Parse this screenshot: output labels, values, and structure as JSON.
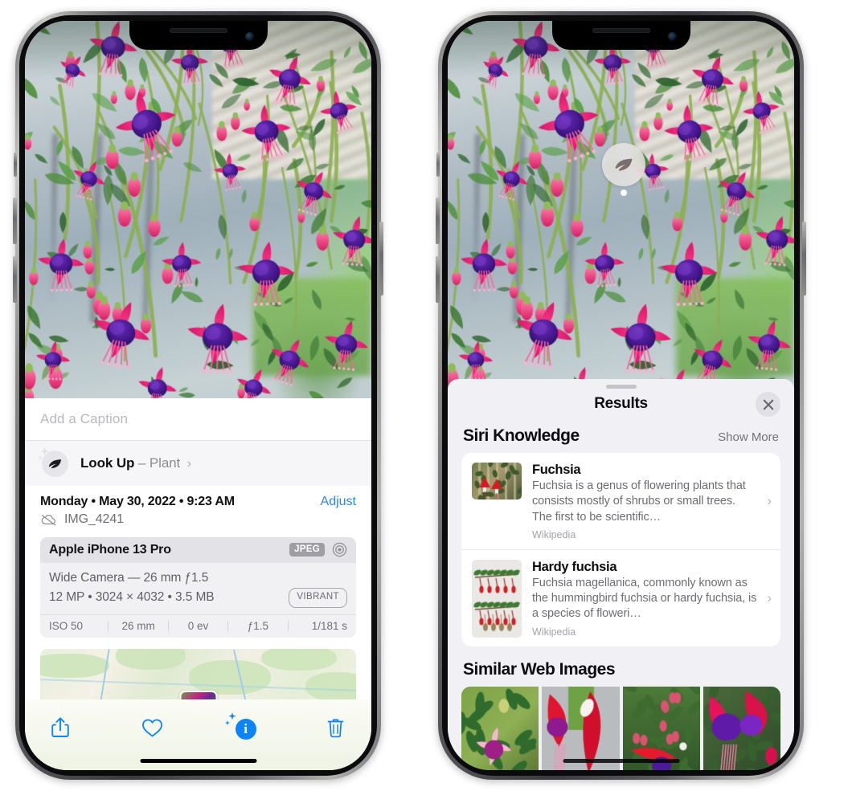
{
  "left_phone": {
    "name": "iPhone showing Photos app info view",
    "caption_input": {
      "placeholder": "Add a Caption",
      "value": ""
    },
    "lookup_row": {
      "icon": "leaf-sparkle-icon",
      "label": "Look Up",
      "dash": "–",
      "subject": "Plant",
      "chevron": "›"
    },
    "metadata": {
      "date": "Monday • May 30, 2022 • 9:23 AM",
      "adjust_label": "Adjust",
      "cloud_icon": "icloud-slash-icon",
      "filename": "IMG_4241"
    },
    "exif": {
      "device": "Apple iPhone 13 Pro",
      "format_badge": "JPEG",
      "raw_icon": "raw-target-icon",
      "lens_line": "Wide Camera — 26 mm ƒ1.5",
      "size_line": "12 MP • 3024 × 4032 • 3.5 MB",
      "style_badge": "VIBRANT",
      "stats": [
        "ISO 50",
        "26 mm",
        "0 ev",
        "ƒ1.5",
        "1/181 s"
      ]
    },
    "toolbar": {
      "share_label": "Share",
      "favorite_label": "Favorite",
      "info_label": "Info",
      "delete_label": "Delete"
    }
  },
  "right_phone": {
    "name": "iPhone showing Visual Look Up results",
    "photo_badge": {
      "icon": "leaf-icon",
      "label": "Plant"
    },
    "sheet": {
      "title": "Results",
      "close_icon": "close-icon",
      "grabber": "drag-handle"
    },
    "siri_knowledge": {
      "heading": "Siri Knowledge",
      "show_more": "Show More",
      "items": [
        {
          "title": "Fuchsia",
          "description": "Fuchsia is a genus of flowering plants that consists mostly of shrubs or small trees. The first to be scientific…",
          "source": "Wikipedia",
          "chevron": "›",
          "thumb": "red-fuchsia-flowers-photo"
        },
        {
          "title": "Hardy fuchsia",
          "description": "Fuchsia magellanica, commonly known as the hummingbird fuchsia or hardy fuchsia, is a species of floweri…",
          "source": "Wikipedia",
          "chevron": "›",
          "thumb": "fuchsia-magellanica-specimen-photo"
        }
      ]
    },
    "similar_web_images": {
      "heading": "Similar Web Images",
      "tiles": [
        "pink-white-fuchsia-on-green-leaves",
        "crimson-fuchsia-closeup",
        "fuchsia-bush-with-buds",
        "purple-magenta-double-fuchsia"
      ]
    }
  },
  "colors": {
    "accent_blue": "#0b84fe",
    "link_blue": "#2b86f2",
    "sheet_bg": "#f1f1f5",
    "card_bg": "#ffffff",
    "text_primary": "#0d0d10",
    "text_secondary": "#6d6d74",
    "text_tertiary": "#a3a3a9"
  }
}
